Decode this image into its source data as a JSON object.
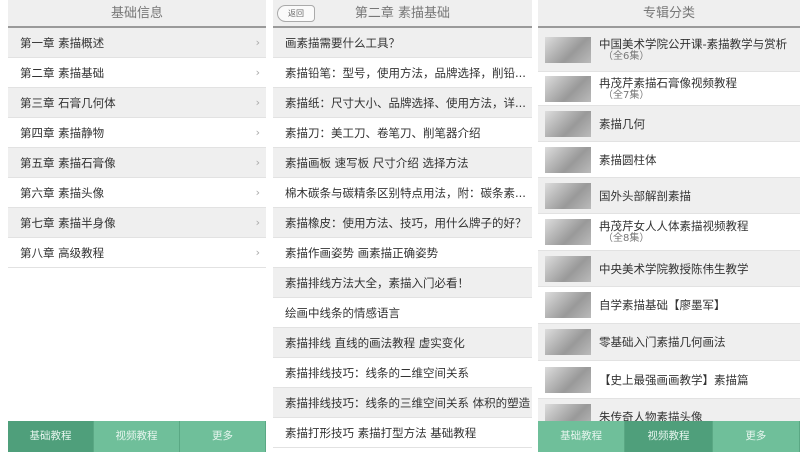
{
  "left": {
    "title": "基础信息",
    "items": [
      {
        "label": "第一章 素描概述"
      },
      {
        "label": "第二章 素描基础"
      },
      {
        "label": "第三章 石膏几何体"
      },
      {
        "label": "第四章 素描静物"
      },
      {
        "label": "第五章 素描石膏像"
      },
      {
        "label": "第六章 素描头像"
      },
      {
        "label": "第七章 素描半身像"
      },
      {
        "label": "第八章 高级教程"
      }
    ],
    "chevron": "›",
    "tabs": [
      {
        "label": "基础教程"
      },
      {
        "label": "视频教程"
      },
      {
        "label": "更多"
      }
    ],
    "selected_tab": "基础教程"
  },
  "middle": {
    "back_label": "返回",
    "title": "第二章 素描基础",
    "items": [
      {
        "label": "画素描需要什么工具？"
      },
      {
        "label": "素描铅笔：型号，使用方法，品牌选择，削铅..."
      },
      {
        "label": "素描纸：尺寸大小、品牌选择、使用方法，详..."
      },
      {
        "label": "素描刀：美工刀、卷笔刀、削笔器介绍"
      },
      {
        "label": "素描画板 速写板 尺寸介绍 选择方法"
      },
      {
        "label": "棉木碳条与碳精条区别特点用法，附：碳条素..."
      },
      {
        "label": "素描橡皮：使用方法、技巧，用什么牌子的好？"
      },
      {
        "label": "素描作画姿势 画素描正确姿势"
      },
      {
        "label": "素描排线方法大全，素描入门必看！"
      },
      {
        "label": "绘画中线条的情感语言"
      },
      {
        "label": "素描排线 直线的画法教程 虚实变化"
      },
      {
        "label": "素描排线技巧：线条的二维空间关系"
      },
      {
        "label": "素描排线技巧：线条的三维空间关系 体积的塑造"
      },
      {
        "label": "素描打形技巧 素描打型方法 基础教程"
      }
    ]
  },
  "right": {
    "title": "专辑分类",
    "items": [
      {
        "label": "中国美术学院公开课-素描教学与赏析",
        "sub": "（全6集）"
      },
      {
        "label": "冉茂芹素描石膏像视频教程",
        "sub": "（全7集）"
      },
      {
        "label": "素描几何",
        "sub": ""
      },
      {
        "label": "素描圆柱体",
        "sub": ""
      },
      {
        "label": "国外头部解剖素描",
        "sub": ""
      },
      {
        "label": "冉茂芹女人人体素描视频教程",
        "sub": "（全8集）"
      },
      {
        "label": "中央美术学院教授陈伟生教学",
        "sub": ""
      },
      {
        "label": "自学素描基础【廖墨军】",
        "sub": ""
      },
      {
        "label": "零基础入门素描几何画法",
        "sub": ""
      },
      {
        "label": "【史上最强画画教学】素描篇",
        "sub": ""
      },
      {
        "label": "朱传奇人物素描头像",
        "sub": ""
      }
    ],
    "tabs": [
      {
        "label": "基础教程"
      },
      {
        "label": "视频教程"
      },
      {
        "label": "更多"
      }
    ],
    "selected_tab": "视频教程"
  },
  "colors": {
    "tab_bar": "#6fbf9a",
    "tab_selected": "#4f9f7b",
    "row_alt": "#efefef"
  }
}
